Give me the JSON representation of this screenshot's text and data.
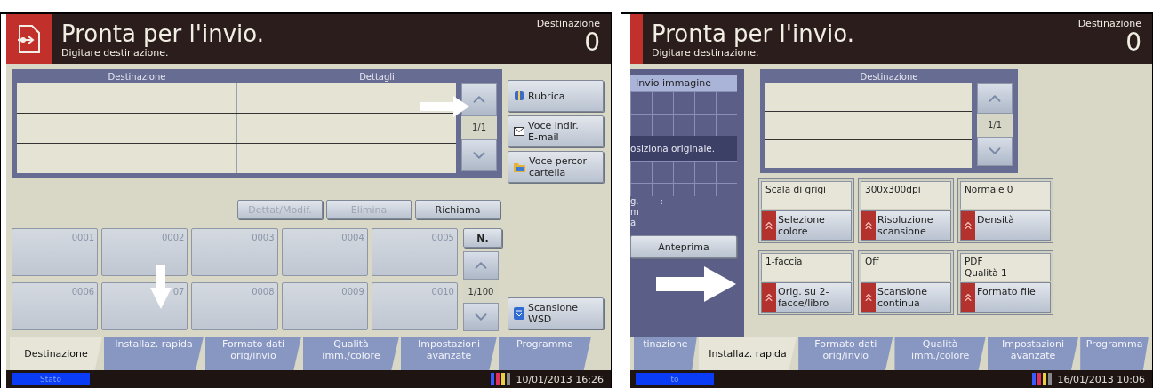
{
  "left_screen": {
    "header": {
      "title": "Pronta per l'invio.",
      "subtitle": "Digitare destinazione.",
      "counter_label": "Destinazione",
      "counter": "0"
    },
    "destination_list": {
      "columns": [
        "Destinazione",
        "Dettagli"
      ],
      "page": "1/1"
    },
    "side_buttons": [
      {
        "label": "Rubrica",
        "kind": "book"
      },
      {
        "label": "Voce indir.\nE-mail",
        "kind": "mail"
      },
      {
        "label": "Voce percor\ncartella",
        "kind": "folder"
      }
    ],
    "list_actions": [
      {
        "label": "Dettat/Modif.",
        "disabled": true
      },
      {
        "label": "Elimina",
        "disabled": true
      },
      {
        "label": "Richiama",
        "disabled": false
      }
    ],
    "speed_dial": {
      "keys": [
        "0001",
        "0002",
        "0003",
        "0004",
        "0005",
        "0006",
        "07",
        "0008",
        "0009",
        "0010"
      ],
      "number_button": "N.",
      "page": "1/100"
    },
    "wsd_button": "Scansione\nWSD",
    "tabs": [
      {
        "label": "Destinazione",
        "selected": true
      },
      {
        "label": "Installaz. rapida",
        "selected": false
      },
      {
        "label": "Formato dati\norig/invio",
        "selected": false
      },
      {
        "label": "Qualità\nimm./colore",
        "selected": false
      },
      {
        "label": "Impostazioni\navanzate",
        "selected": false
      },
      {
        "label": "Programma",
        "selected": false
      }
    ],
    "status": {
      "badge": "Stato",
      "datetime": "10/01/2013 16:26"
    }
  },
  "right_screen": {
    "header": {
      "title": "Pronta per l'invio.",
      "subtitle": "Digitare destinazione.",
      "counter_label": "Destinazione",
      "counter": "0"
    },
    "preview_panel": {
      "title": "Invio immagine",
      "message": "osiziona originale.",
      "info": [
        {
          "label": "g.",
          "value": ": ---"
        },
        {
          "label": "m"
        },
        {
          "label": "a"
        }
      ],
      "button": "Anteprima"
    },
    "destination_list": {
      "columns": [
        "Destinazione"
      ],
      "page": "1/1"
    },
    "settings": [
      {
        "current": "Scala di grigi",
        "button": "Selezione\ncolore"
      },
      {
        "current": "300x300dpi",
        "button": "Risoluzione\nscansione"
      },
      {
        "current": "Normale 0",
        "button": "Densità"
      },
      {
        "current": "1-faccia",
        "button": "Orig. su 2-\nfacce/libro"
      },
      {
        "current": "Off",
        "button": "Scansione\ncontinua"
      },
      {
        "current": "PDF\nQualità 1",
        "button": "Formato file"
      }
    ],
    "tabs": [
      {
        "label": "tinazione",
        "selected": false
      },
      {
        "label": "Installaz. rapida",
        "selected": true
      },
      {
        "label": "Formato dati\norig/invio",
        "selected": false
      },
      {
        "label": "Qualità\nimm./colore",
        "selected": false
      },
      {
        "label": "Impostazioni\navanzate",
        "selected": false
      },
      {
        "label": "Programma",
        "selected": false
      }
    ],
    "status": {
      "badge": "to",
      "datetime": "16/01/2013 10:06"
    }
  }
}
